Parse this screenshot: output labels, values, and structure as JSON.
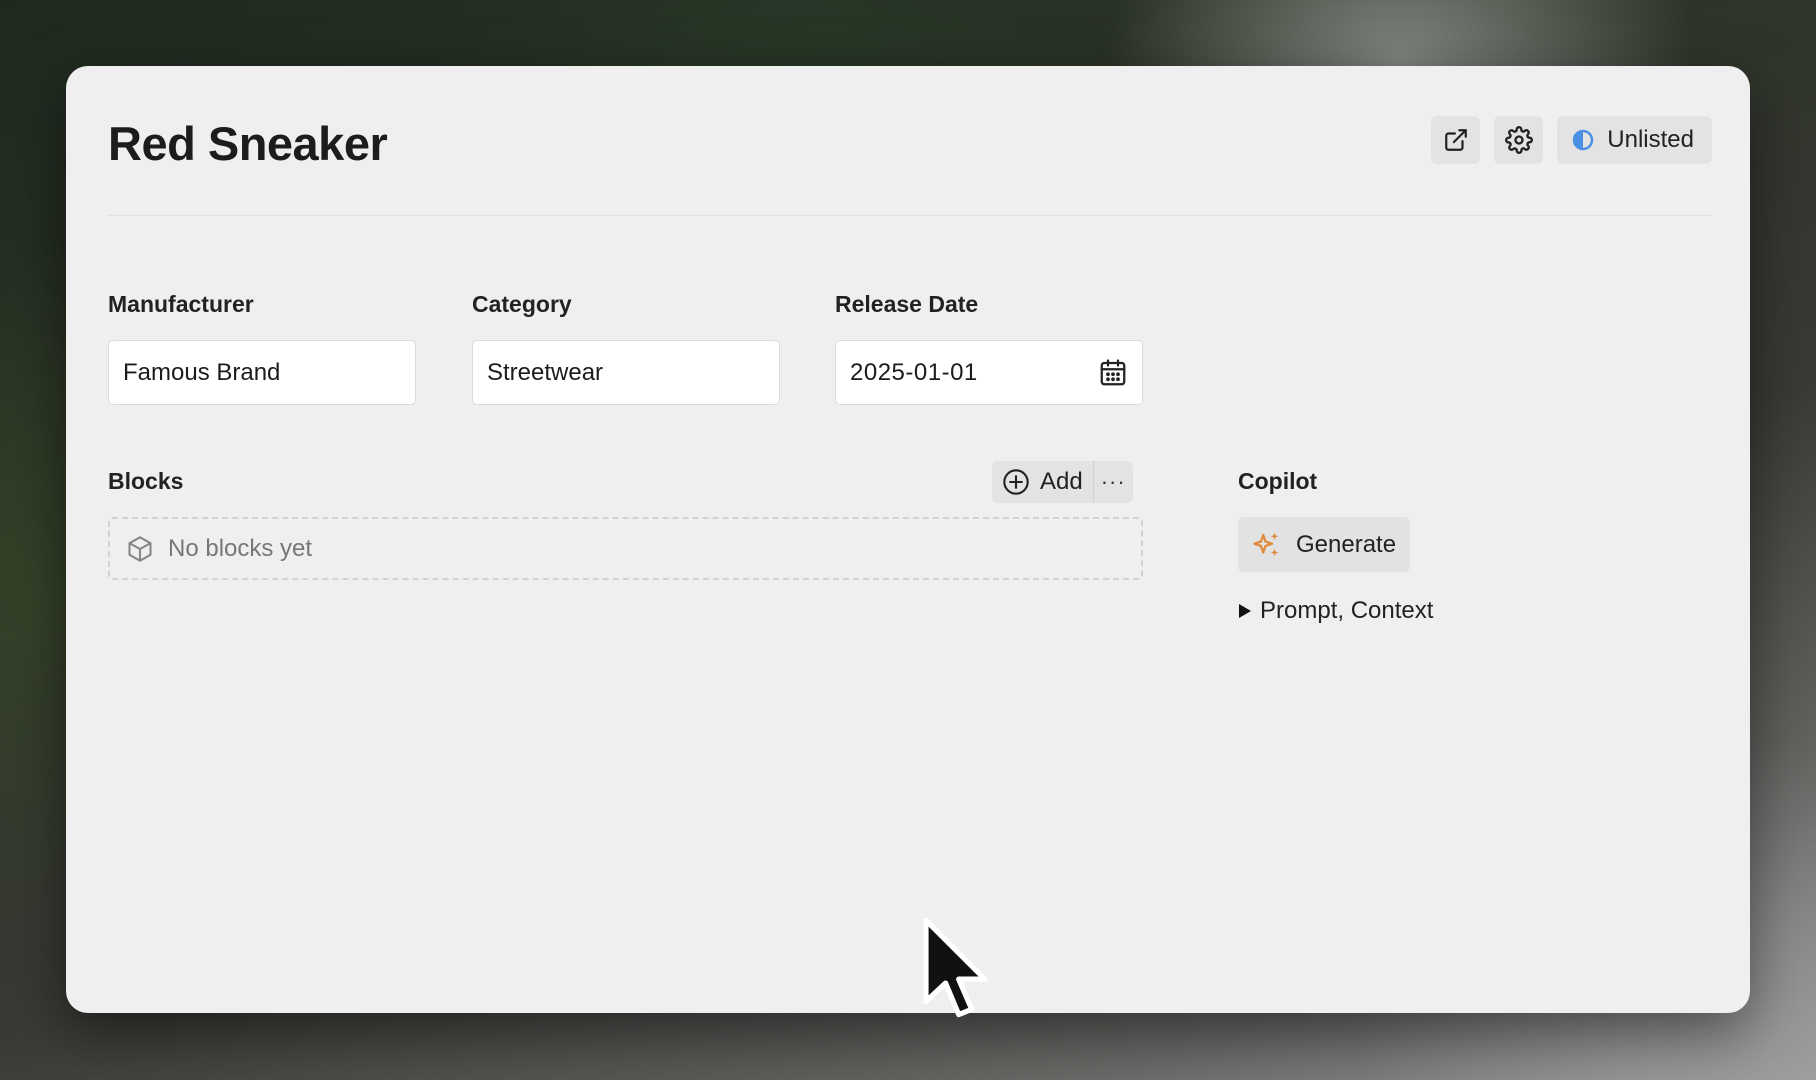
{
  "page": {
    "title": "Red Sneaker"
  },
  "header": {
    "open_icon": "external-link-icon",
    "settings_icon": "gear-icon",
    "status": {
      "label": "Unlisted",
      "icon": "half-circle-icon",
      "icon_color": "#4a90e2"
    }
  },
  "fields": {
    "manufacturer": {
      "label": "Manufacturer",
      "value": "Famous Brand"
    },
    "category": {
      "label": "Category",
      "value": "Streetwear"
    },
    "release_date": {
      "label": "Release Date",
      "value": "2025-01-01",
      "icon": "calendar-icon"
    }
  },
  "blocks": {
    "heading": "Blocks",
    "add_label": "Add",
    "more_label": "···",
    "empty_text": "No blocks yet",
    "empty_icon": "cube-icon"
  },
  "copilot": {
    "heading": "Copilot",
    "generate_label": "Generate",
    "generate_icon": "sparkle-icon",
    "sparkle_color": "#e08a3c",
    "disclosure_label": "Prompt, Context"
  }
}
